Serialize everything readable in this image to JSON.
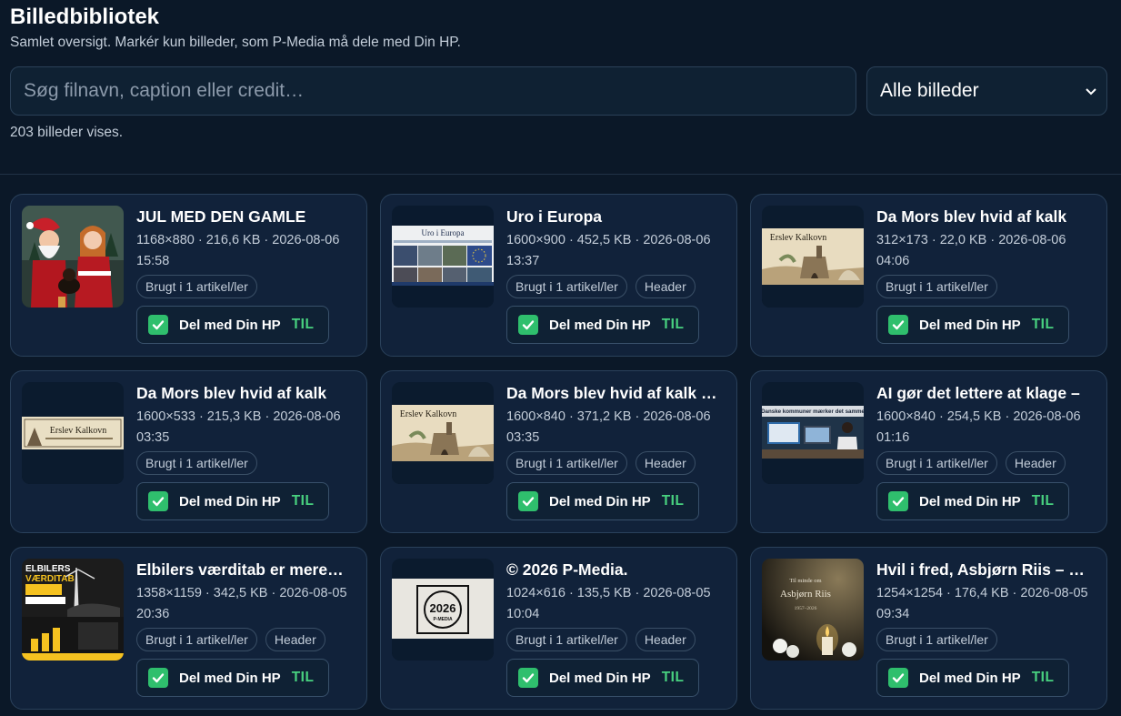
{
  "header": {
    "title": "Billedbibliotek",
    "subtitle": "Samlet oversigt. Markér kun billeder, som P-Media må dele med Din HP."
  },
  "search": {
    "placeholder": "Søg filnavn, caption eller credit…",
    "value": ""
  },
  "filter": {
    "selected": "Alle billeder"
  },
  "count_text": "203 billeder vises.",
  "share_label": "Del med Din HP",
  "share_state": "TIL",
  "colors": {
    "background": "#0b1828",
    "card": "#11223a",
    "accent_green": "#2fbf6d",
    "toggle_text": "#48d17f"
  },
  "cards": [
    {
      "title": "JUL MED DEN GAMLE",
      "meta": "1168×880 · 216,6 KB · 2026-08-06 15:58",
      "chips": [
        "Brugt i 1 artikel/ler"
      ],
      "thumb": "santa-christmas-illustration",
      "shared": true
    },
    {
      "title": "Uro i Europa",
      "meta": "1600×900 · 452,5 KB · 2026-08-06 13:37",
      "chips": [
        "Brugt i 1 artikel/ler",
        "Header"
      ],
      "thumb": "europe-news-collage",
      "thumb_text": "Uro i Europa",
      "shared": true
    },
    {
      "title": "Da Mors blev hvid af kalk",
      "meta": "312×173 · 22,0 KB · 2026-08-06 04:06",
      "chips": [
        "Brugt i 1 artikel/ler"
      ],
      "thumb": "lime-kiln-drawing",
      "thumb_text": "Erslev Kalkovn",
      "shared": true
    },
    {
      "title": "Da Mors blev hvid af kalk",
      "meta": "1600×533 · 215,3 KB · 2026-08-06 03:35",
      "chips": [
        "Brugt i 1 artikel/ler"
      ],
      "thumb": "lime-kiln-banner",
      "thumb_text": "Erslev Kalkovn",
      "shared": true
    },
    {
      "title": "Da Mors blev hvid af kalk …",
      "meta": "1600×840 · 371,2 KB · 2026-08-06 03:35",
      "chips": [
        "Brugt i 1 artikel/ler",
        "Header"
      ],
      "thumb": "lime-kiln-drawing",
      "thumb_text": "Erslev Kalkovn",
      "shared": true
    },
    {
      "title": "AI gør det lettere at klage –",
      "meta": "1600×840 · 254,5 KB · 2026-08-06 01:16",
      "chips": [
        "Brugt i 1 artikel/ler",
        "Header"
      ],
      "thumb": "office-computer-photo",
      "thumb_text": "Danske kommuner mærker det samme",
      "shared": true
    },
    {
      "title": "Elbilers værditab er mere…",
      "meta": "1358×1159 · 342,5 KB · 2026-08-05 20:36",
      "chips": [
        "Brugt i 1 artikel/ler",
        "Header"
      ],
      "thumb": "ev-depreciation-poster",
      "thumb_text": "ELBILERS VÆRDITAB",
      "shared": true
    },
    {
      "title": "© 2026 P-Media.",
      "meta": "1024×616 · 135,5 KB · 2026-08-05 10:04",
      "chips": [
        "Brugt i 1 artikel/ler",
        "Header"
      ],
      "thumb": "p-media-logo",
      "thumb_text": "2026",
      "thumb_sub": "P-MEDIA",
      "shared": true
    },
    {
      "title": "Hvil i fred, Asbjørn Riis – …",
      "meta": "1254×1254 · 176,4 KB · 2026-08-05 09:34",
      "chips": [
        "Brugt i 1 artikel/ler"
      ],
      "thumb": "memorial-candle",
      "thumb_text": "Asbjørn Riis",
      "thumb_sub": "1957–2026",
      "thumb_top": "Til minde om",
      "shared": true
    }
  ]
}
